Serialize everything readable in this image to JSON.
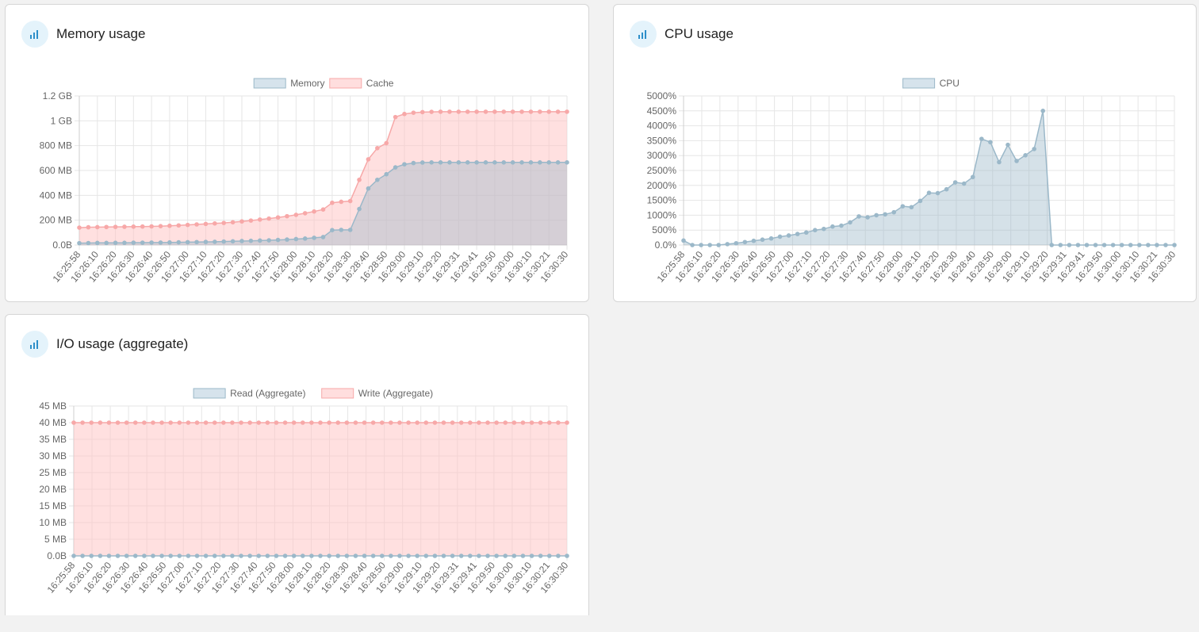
{
  "panels": {
    "memory": {
      "title": "Memory usage",
      "icon": "bar-chart-icon"
    },
    "cpu": {
      "title": "CPU usage",
      "icon": "bar-chart-icon"
    },
    "io": {
      "title": "I/O usage (aggregate)",
      "icon": "bar-chart-icon"
    }
  },
  "colors": {
    "blue_line": "#9bb8c9",
    "blue_fill": "rgba(155,184,201,0.42)",
    "blue_legend": "#d6e3ec",
    "pink_line": "#f7a8a8",
    "pink_fill": "rgba(255,194,194,0.5)",
    "pink_legend": "#ffdede",
    "grid": "#e6e6e6",
    "accent": "#2d8fc9"
  },
  "chart_data": [
    {
      "id": "memory",
      "type": "area",
      "title": "Memory usage",
      "legend": "top",
      "grid": true,
      "ylim": [
        0,
        1200
      ],
      "y_unit": "MB",
      "y_ticks": [
        {
          "value": 0,
          "label": "0.0B"
        },
        {
          "value": 200,
          "label": "200 MB"
        },
        {
          "value": 400,
          "label": "400 MB"
        },
        {
          "value": 600,
          "label": "600 MB"
        },
        {
          "value": 800,
          "label": "800 MB"
        },
        {
          "value": 1000,
          "label": "1 GB"
        },
        {
          "value": 1200,
          "label": "1.2 GB"
        }
      ],
      "x_ticks": [
        "16:25:58",
        "16:26:10",
        "16:26:20",
        "16:26:30",
        "16:26:40",
        "16:26:50",
        "16:27:00",
        "16:27:10",
        "16:27:20",
        "16:27:30",
        "16:27:40",
        "16:27:50",
        "16:28:00",
        "16:28:10",
        "16:28:20",
        "16:28:30",
        "16:28:40",
        "16:28:50",
        "16:29:00",
        "16:29:10",
        "16:29:20",
        "16:29:31",
        "16:29:41",
        "16:29:50",
        "16:30:00",
        "16:30:10",
        "16:30:21",
        "16:30:30"
      ],
      "series": [
        {
          "name": "Cache",
          "color": "pink",
          "values": [
            140,
            143,
            144,
            145,
            146,
            147,
            148,
            149,
            150,
            152,
            155,
            158,
            162,
            166,
            170,
            174,
            178,
            183,
            190,
            197,
            205,
            213,
            222,
            232,
            243,
            256,
            270,
            286,
            340,
            348,
            354,
            525,
            690,
            780,
            820,
            1030,
            1055,
            1065,
            1070,
            1072,
            1073,
            1073,
            1073,
            1073,
            1073,
            1073,
            1073,
            1073,
            1073,
            1073,
            1073,
            1073,
            1073,
            1073,
            1073
          ]
        },
        {
          "name": "Memory",
          "color": "blue",
          "values": [
            15,
            16,
            17,
            17,
            18,
            18,
            19,
            19,
            20,
            20,
            21,
            22,
            23,
            24,
            25,
            26,
            28,
            30,
            32,
            34,
            36,
            38,
            41,
            44,
            48,
            52,
            58,
            64,
            120,
            122,
            122,
            290,
            455,
            525,
            570,
            625,
            650,
            660,
            664,
            665,
            665,
            665,
            665,
            665,
            665,
            665,
            665,
            665,
            665,
            665,
            665,
            665,
            665,
            665,
            665
          ]
        }
      ]
    },
    {
      "id": "cpu",
      "type": "area",
      "title": "CPU usage",
      "legend": "top",
      "grid": true,
      "ylim": [
        0,
        5000
      ],
      "y_unit": "%",
      "y_ticks": [
        {
          "value": 0,
          "label": "0.0%"
        },
        {
          "value": 500,
          "label": "500%"
        },
        {
          "value": 1000,
          "label": "1000%"
        },
        {
          "value": 1500,
          "label": "1500%"
        },
        {
          "value": 2000,
          "label": "2000%"
        },
        {
          "value": 2500,
          "label": "2500%"
        },
        {
          "value": 3000,
          "label": "3000%"
        },
        {
          "value": 3500,
          "label": "3500%"
        },
        {
          "value": 4000,
          "label": "4000%"
        },
        {
          "value": 4500,
          "label": "4500%"
        },
        {
          "value": 5000,
          "label": "5000%"
        }
      ],
      "x_ticks": [
        "16:25:58",
        "16:26:10",
        "16:26:20",
        "16:26:30",
        "16:26:40",
        "16:26:50",
        "16:27:00",
        "16:27:10",
        "16:27:20",
        "16:27:30",
        "16:27:40",
        "16:27:50",
        "16:28:00",
        "16:28:10",
        "16:28:20",
        "16:28:30",
        "16:28:40",
        "16:28:50",
        "16:29:00",
        "16:29:10",
        "16:29:20",
        "16:29:31",
        "16:29:41",
        "16:29:50",
        "16:30:00",
        "16:30:10",
        "16:30:21",
        "16:30:30"
      ],
      "series": [
        {
          "name": "CPU",
          "color": "blue",
          "values": [
            150,
            0,
            0,
            0,
            0,
            30,
            60,
            100,
            140,
            180,
            220,
            280,
            320,
            370,
            420,
            500,
            540,
            620,
            650,
            760,
            960,
            930,
            1000,
            1030,
            1100,
            1300,
            1270,
            1480,
            1750,
            1740,
            1870,
            2100,
            2060,
            2280,
            3560,
            3450,
            2780,
            3360,
            2820,
            3010,
            3220,
            4500,
            0,
            0,
            0,
            0,
            0,
            0,
            0,
            0,
            0,
            0,
            0,
            0,
            0,
            0,
            0
          ]
        }
      ]
    },
    {
      "id": "io",
      "type": "area",
      "title": "I/O usage (aggregate)",
      "legend": "top",
      "grid": true,
      "ylim": [
        0,
        45
      ],
      "y_unit": "MB",
      "y_ticks": [
        {
          "value": 0,
          "label": "0.0B"
        },
        {
          "value": 5,
          "label": "5 MB"
        },
        {
          "value": 10,
          "label": "10 MB"
        },
        {
          "value": 15,
          "label": "15 MB"
        },
        {
          "value": 20,
          "label": "20 MB"
        },
        {
          "value": 25,
          "label": "25 MB"
        },
        {
          "value": 30,
          "label": "30 MB"
        },
        {
          "value": 35,
          "label": "35 MB"
        },
        {
          "value": 40,
          "label": "40 MB"
        },
        {
          "value": 45,
          "label": "45 MB"
        }
      ],
      "x_ticks": [
        "16:25:58",
        "16:26:10",
        "16:26:20",
        "16:26:30",
        "16:26:40",
        "16:26:50",
        "16:27:00",
        "16:27:10",
        "16:27:20",
        "16:27:30",
        "16:27:40",
        "16:27:50",
        "16:28:00",
        "16:28:10",
        "16:28:20",
        "16:28:30",
        "16:28:40",
        "16:28:50",
        "16:29:00",
        "16:29:10",
        "16:29:20",
        "16:29:31",
        "16:29:41",
        "16:29:50",
        "16:30:00",
        "16:30:10",
        "16:30:21",
        "16:30:30"
      ],
      "series": [
        {
          "name": "Write (Aggregate)",
          "color": "pink",
          "values": [
            40,
            40,
            40,
            40,
            40,
            40,
            40,
            40,
            40,
            40,
            40,
            40,
            40,
            40,
            40,
            40,
            40,
            40,
            40,
            40,
            40,
            40,
            40,
            40,
            40,
            40,
            40,
            40,
            40,
            40,
            40,
            40,
            40,
            40,
            40,
            40,
            40,
            40,
            40,
            40,
            40,
            40,
            40,
            40,
            40,
            40,
            40,
            40,
            40,
            40,
            40,
            40,
            40,
            40,
            40,
            40,
            40
          ]
        },
        {
          "name": "Read (Aggregate)",
          "color": "blue",
          "values": [
            0,
            0,
            0,
            0,
            0,
            0,
            0,
            0,
            0,
            0,
            0,
            0,
            0,
            0,
            0,
            0,
            0,
            0,
            0,
            0,
            0,
            0,
            0,
            0,
            0,
            0,
            0,
            0,
            0,
            0,
            0,
            0,
            0,
            0,
            0,
            0,
            0,
            0,
            0,
            0,
            0,
            0,
            0,
            0,
            0,
            0,
            0,
            0,
            0,
            0,
            0,
            0,
            0,
            0,
            0,
            0,
            0
          ]
        }
      ],
      "legend_order": [
        "Read (Aggregate)",
        "Write (Aggregate)"
      ]
    }
  ],
  "legends": {
    "memory": [
      "Memory",
      "Cache"
    ],
    "cpu": [
      "CPU"
    ],
    "io": [
      "Read (Aggregate)",
      "Write (Aggregate)"
    ]
  }
}
